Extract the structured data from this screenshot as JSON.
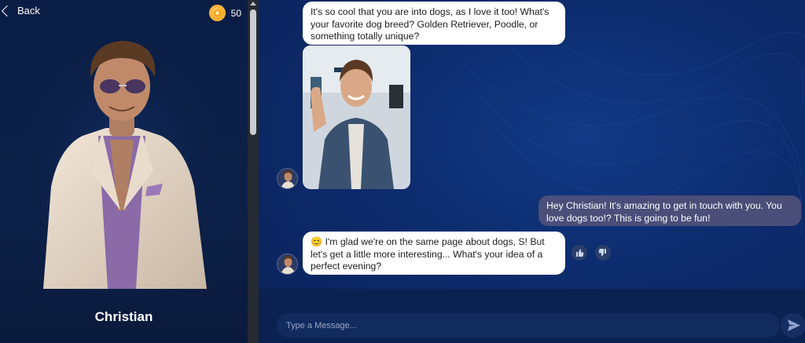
{
  "header": {
    "back_label": "Back",
    "coins": "50"
  },
  "character": {
    "name": "Christian"
  },
  "messages": [
    {
      "from": "bot",
      "text": "It's so cool that you are into dogs, as I love it too! What's your favorite dog breed? Golden Retriever, Poodle, or something totally unique?"
    },
    {
      "from": "bot",
      "type": "image"
    },
    {
      "from": "user",
      "text": "Hey Christian! It's amazing to get in touch with you. You love dogs too!? This is going to be fun!"
    },
    {
      "from": "bot",
      "emoji": "😊",
      "text": "I'm glad we're on the same page about dogs, S! But let's get a little more interesting... What's your idea of a perfect evening?"
    }
  ],
  "composer": {
    "placeholder": "Type a Message..."
  },
  "icons": {
    "back": "chevron-left-icon",
    "coin": "coin-icon",
    "like": "thumbs-up-icon",
    "dislike": "thumbs-down-icon",
    "send": "send-icon"
  },
  "colors": {
    "accent_gold": "#f5a623",
    "user_bubble": "#4a4e78",
    "bot_bubble": "#ffffff",
    "chat_bg": "#0d2c6e"
  }
}
